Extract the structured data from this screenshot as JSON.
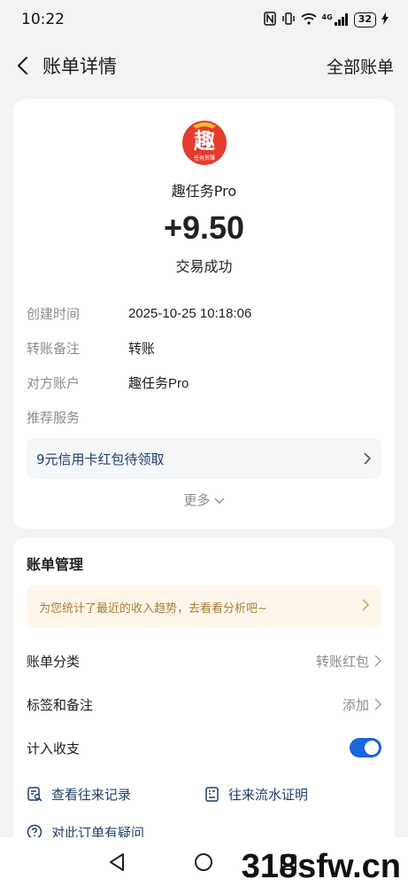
{
  "status_bar": {
    "time": "10:22",
    "network": "4G",
    "battery": "32"
  },
  "nav": {
    "title": "账单详情",
    "right_action": "全部账单"
  },
  "transaction": {
    "merchant_logo_char": "趣",
    "merchant_logo_caption": "任务赏赚",
    "merchant_name": "趣任务Pro",
    "amount": "+9.50",
    "status": "交易成功",
    "details": [
      {
        "label": "创建时间",
        "value": "2025-10-25 10:18:06"
      },
      {
        "label": "转账备注",
        "value": "转账"
      },
      {
        "label": "对方账户",
        "value": "趣任务Pro"
      },
      {
        "label": "推荐服务",
        "value": ""
      }
    ],
    "promo_text": "9元信用卡红包待领取",
    "more_label": "更多"
  },
  "manage": {
    "title": "账单管理",
    "tip_text": "为您统计了最近的收入趋势，去看看分析吧~",
    "rows": [
      {
        "label": "账单分类",
        "value": "转账红包"
      },
      {
        "label": "标签和备注",
        "value": "添加"
      },
      {
        "label": "计入收支",
        "toggle_on": true
      }
    ],
    "links": {
      "history": "查看往来记录",
      "proof": "往来流水证明",
      "question": "对此订单有疑问"
    }
  },
  "watermark": "318sfw.cn",
  "colors": {
    "accent": "#1a66e0",
    "link": "#1d3f6b",
    "tip_bg": "#fdf6e9",
    "tip_text": "#a87b3a",
    "logo_red": "#e53b2c"
  }
}
